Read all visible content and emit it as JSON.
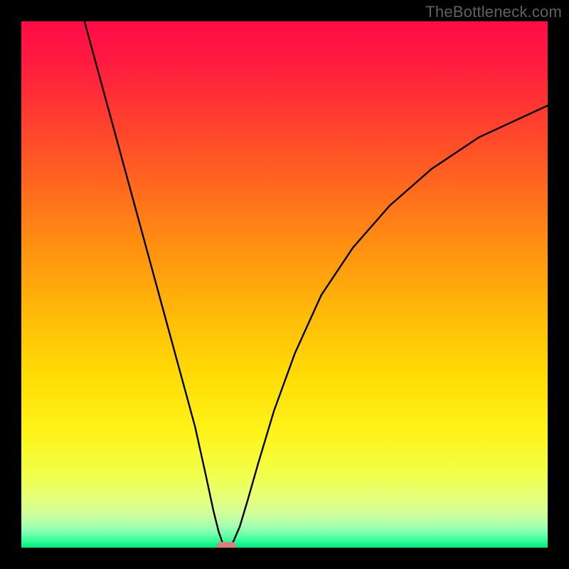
{
  "watermark": "TheBottleneck.com",
  "chart_data": {
    "type": "line",
    "title": "",
    "xlabel": "",
    "ylabel": "",
    "xlim": [
      0,
      100
    ],
    "ylim": [
      0,
      100
    ],
    "curve": [
      {
        "x": 12,
        "y": 100
      },
      {
        "x": 15,
        "y": 89
      },
      {
        "x": 18,
        "y": 78
      },
      {
        "x": 21,
        "y": 67
      },
      {
        "x": 24,
        "y": 56
      },
      {
        "x": 27,
        "y": 45
      },
      {
        "x": 30,
        "y": 34
      },
      {
        "x": 33,
        "y": 23
      },
      {
        "x": 35,
        "y": 14
      },
      {
        "x": 36.5,
        "y": 7
      },
      {
        "x": 37.5,
        "y": 3
      },
      {
        "x": 38.2,
        "y": 1
      },
      {
        "x": 38.8,
        "y": 0.3
      },
      {
        "x": 39.5,
        "y": 0.3
      },
      {
        "x": 40.3,
        "y": 1.2
      },
      {
        "x": 41.5,
        "y": 4
      },
      {
        "x": 43,
        "y": 9
      },
      {
        "x": 45,
        "y": 16
      },
      {
        "x": 48,
        "y": 26
      },
      {
        "x": 52,
        "y": 37
      },
      {
        "x": 57,
        "y": 48
      },
      {
        "x": 63,
        "y": 57
      },
      {
        "x": 70,
        "y": 65
      },
      {
        "x": 78,
        "y": 72
      },
      {
        "x": 87,
        "y": 78
      },
      {
        "x": 100,
        "y": 84
      }
    ],
    "marker": {
      "x": 39,
      "y": 0.3,
      "w": 3.6,
      "h": 1.6
    },
    "gradient_stops": [
      {
        "pos": 0,
        "color": "#ff0b48"
      },
      {
        "pos": 0.08,
        "color": "#ff1c3f"
      },
      {
        "pos": 0.18,
        "color": "#ff3c30"
      },
      {
        "pos": 0.3,
        "color": "#ff6420"
      },
      {
        "pos": 0.42,
        "color": "#ff8e12"
      },
      {
        "pos": 0.55,
        "color": "#ffb808"
      },
      {
        "pos": 0.68,
        "color": "#ffde06"
      },
      {
        "pos": 0.78,
        "color": "#fff31a"
      },
      {
        "pos": 0.86,
        "color": "#f2ff4a"
      },
      {
        "pos": 0.905,
        "color": "#e6ff7a"
      },
      {
        "pos": 0.935,
        "color": "#d0ff9a"
      },
      {
        "pos": 0.958,
        "color": "#a8ffb0"
      },
      {
        "pos": 0.975,
        "color": "#6fffad"
      },
      {
        "pos": 0.988,
        "color": "#2bff98"
      },
      {
        "pos": 1.0,
        "color": "#00e676"
      }
    ]
  }
}
